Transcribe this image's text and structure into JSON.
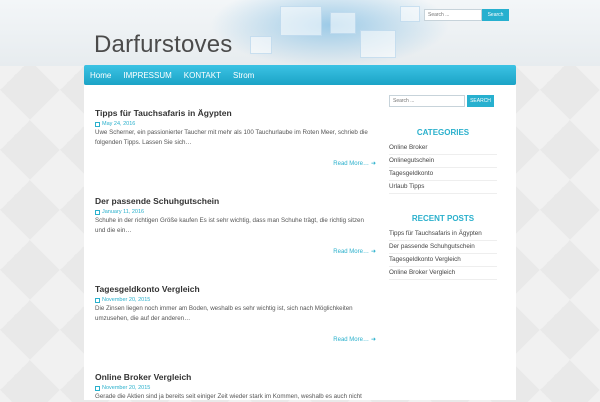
{
  "header": {
    "site_title": "Darfurstoves",
    "search": {
      "placeholder": "Search ...",
      "button_label": "Search"
    }
  },
  "nav": {
    "items": [
      {
        "label": "Home"
      },
      {
        "label": "IMPRESSUM"
      },
      {
        "label": "KONTAKT"
      },
      {
        "label": "Strom"
      }
    ]
  },
  "posts": [
    {
      "title": "Tipps für Tauchsafaris in Ägypten",
      "date": "May 24, 2016",
      "excerpt": "Uwe Scherner, ein passionierter Taucher mit mehr als 100 Tauchurlaube im Roten Meer, schrieb die folgenden Tipps. Lassen Sie sich…",
      "read_more": "Read More…"
    },
    {
      "title": "Der passende Schuhgutschein",
      "date": "January 11, 2016",
      "excerpt": "Schuhe in der richtigen Größe kaufen Es ist sehr wichtig, dass man Schuhe trägt, die richtig sitzen und die ein…",
      "read_more": "Read More…"
    },
    {
      "title": "Tagesgeldkonto Vergleich",
      "date": "November 20, 2015",
      "excerpt": "Die Zinsen liegen noch immer am Boden, weshalb es sehr wichtig ist, sich nach Möglichkeiten umzusehen, die auf der anderen…",
      "read_more": "Read More…"
    },
    {
      "title": "Online Broker Vergleich",
      "date": "November 20, 2015",
      "excerpt": "Gerade die Aktien sind ja bereits seit einiger Zeit wieder stark im Kommen, weshalb es auch nicht",
      "read_more": ""
    }
  ],
  "sidebar": {
    "search": {
      "placeholder": "Search ...",
      "button_label": "SEARCH"
    },
    "categories": {
      "title": "CATEGORIES",
      "items": [
        "Online Broker",
        "Onlinegutschein",
        "Tagesgeldkonto",
        "Urlaub Tipps"
      ]
    },
    "recent_posts": {
      "title": "RECENT POSTS",
      "items": [
        "Tipps für Tauchsafaris in Ägypten",
        "Der passende Schuhgutschein",
        "Tagesgeldkonto Vergleich",
        "Online Broker Vergleich"
      ]
    }
  },
  "colors": {
    "accent": "#27b0cf",
    "nav_top": "#3cc3e4",
    "nav_bottom": "#1ba3c6",
    "title": "#4b4b4b"
  }
}
